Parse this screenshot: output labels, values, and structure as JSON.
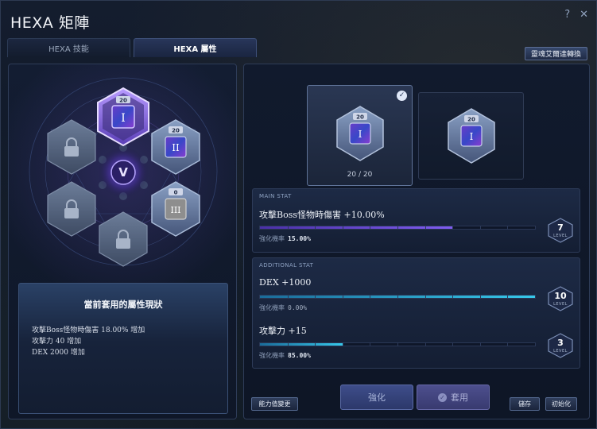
{
  "window": {
    "title": "HEXA 矩陣",
    "help_label": "?",
    "close_label": "✕"
  },
  "tabs": [
    {
      "label": "HEXA 技能",
      "active": false
    },
    {
      "label": "HEXA 屬性",
      "active": true
    }
  ],
  "convert_button": "靈魂艾爾達轉換",
  "hex_grid": {
    "center_icon": "v-logo-icon",
    "cores": [
      {
        "slot": "top",
        "badge": "20",
        "numeral": "I",
        "state": "active-selected"
      },
      {
        "slot": "upper-right",
        "badge": "20",
        "numeral": "II",
        "state": "active"
      },
      {
        "slot": "lower-right",
        "badge": "0",
        "numeral": "III",
        "state": "active"
      },
      {
        "slot": "upper-left",
        "state": "locked",
        "icon": "lock-icon"
      },
      {
        "slot": "lower-left",
        "state": "locked",
        "icon": "lock-icon"
      },
      {
        "slot": "bottom",
        "state": "locked",
        "icon": "lock-icon"
      }
    ]
  },
  "status_box": {
    "title": "當前套用的屬性現狀",
    "lines": [
      "攻擊Boss怪物時傷害 18.00% 增加",
      "攻擊力 40 增加",
      "DEX 2000 增加"
    ]
  },
  "core_cards": [
    {
      "badge": "20",
      "numeral": "I",
      "count": "20 / 20",
      "selected": true
    },
    {
      "badge": "20",
      "numeral": "I",
      "selected": false
    }
  ],
  "main_stat": {
    "header": "MAIN STAT",
    "name": "攻擊Boss怪物時傷害 +10.00%",
    "rate_label": "強化機率",
    "rate_value": "15.00%",
    "level": "7",
    "level_label": "LEVEL",
    "progress": 0.7,
    "segments": 10
  },
  "additional_stat": {
    "header": "ADDITIONAL STAT",
    "items": [
      {
        "name": "DEX +1000",
        "rate_label": "強化機率",
        "rate_value": "0.00%",
        "level": "10",
        "level_label": "LEVEL",
        "progress": 1.0,
        "segments": 10
      },
      {
        "name": "攻擊力 +15",
        "rate_label": "強化機率",
        "rate_value": "85.00%",
        "level": "3",
        "level_label": "LEVEL",
        "progress": 0.3,
        "segments": 10
      }
    ]
  },
  "buttons": {
    "change": "能力值變更",
    "enhance": "強化",
    "apply": "套用",
    "save": "儲存",
    "reset": "初始化"
  },
  "colors": {
    "accent_purple": "#7f5cf0",
    "accent_cyan": "#36c8ea",
    "panel_border": "#2e3c58"
  }
}
